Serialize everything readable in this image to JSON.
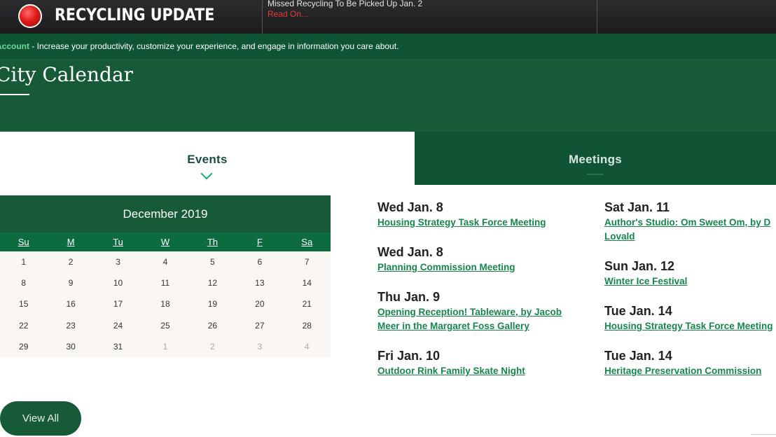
{
  "alert": {
    "title": "RECYCLING UPDATE",
    "news_title": "Missed Recycling To Be Picked Up Jan. 2",
    "news_link": "Read On..."
  },
  "account": {
    "link": "Account",
    "text": " - Increase your productivity, customize your experience, and engage in information you care about."
  },
  "page": {
    "title": "City Calendar"
  },
  "tabs": [
    {
      "label": "Events",
      "active": true
    },
    {
      "label": "Meetings",
      "active": false
    }
  ],
  "calendar": {
    "month": "December 2019",
    "weekdays": [
      "Su",
      "M",
      "Tu",
      "W",
      "Th",
      "F",
      "Sa"
    ],
    "weeks": [
      [
        "1",
        "2",
        "3",
        "4",
        "5",
        "6",
        "7"
      ],
      [
        "8",
        "9",
        "10",
        "11",
        "12",
        "13",
        "14"
      ],
      [
        "15",
        "16",
        "17",
        "18",
        "19",
        "20",
        "21"
      ],
      [
        "22",
        "23",
        "24",
        "25",
        "26",
        "27",
        "28"
      ],
      [
        "29",
        "30",
        "31",
        "1",
        "2",
        "3",
        "4"
      ]
    ]
  },
  "view_all": "View All",
  "events": {
    "col_a": [
      {
        "date": "Wed Jan. 8",
        "title": "Housing Strategy Task Force Meeting"
      },
      {
        "date": "Wed Jan. 8",
        "title": "Planning Commission Meeting"
      },
      {
        "date": "Thu Jan. 9",
        "title": "Opening Reception! Tableware, by Jacob Meer in the Margaret Foss Gallery"
      },
      {
        "date": "Fri Jan. 10",
        "title": "Outdoor Rink Family Skate Night"
      }
    ],
    "col_b": [
      {
        "date": "Sat Jan. 11",
        "title": "Author's Studio: Om Sweet Om, by D Lovald"
      },
      {
        "date": "Sun Jan. 12",
        "title": "Winter Ice Festival"
      },
      {
        "date": "Tue Jan. 14",
        "title": "Housing Strategy Task Force Meeting"
      },
      {
        "date": "Tue Jan. 14",
        "title": "Heritage Preservation Commission"
      }
    ]
  },
  "colors": {
    "brand_green": "#175a37",
    "dark_green": "#0f5535",
    "link_green": "#16864b",
    "alert_red": "#e21b1b"
  }
}
